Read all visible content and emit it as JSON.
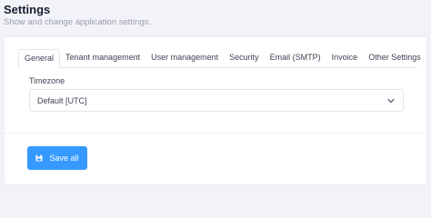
{
  "header": {
    "title": "Settings",
    "subtitle": "Show and change application settings."
  },
  "tabs": [
    {
      "label": "General",
      "active": true
    },
    {
      "label": "Tenant management"
    },
    {
      "label": "User management"
    },
    {
      "label": "Security"
    },
    {
      "label": "Email (SMTP)"
    },
    {
      "label": "Invoice"
    },
    {
      "label": "Other Settings"
    }
  ],
  "general": {
    "timezone_label": "Timezone",
    "timezone_value": "Default [UTC]",
    "chevron_icon": "chevron-down-icon"
  },
  "actions": {
    "save_label": "Save all",
    "save_icon": "save-icon"
  },
  "colors": {
    "primary": "#3699ff",
    "background": "#f2f3f8"
  }
}
